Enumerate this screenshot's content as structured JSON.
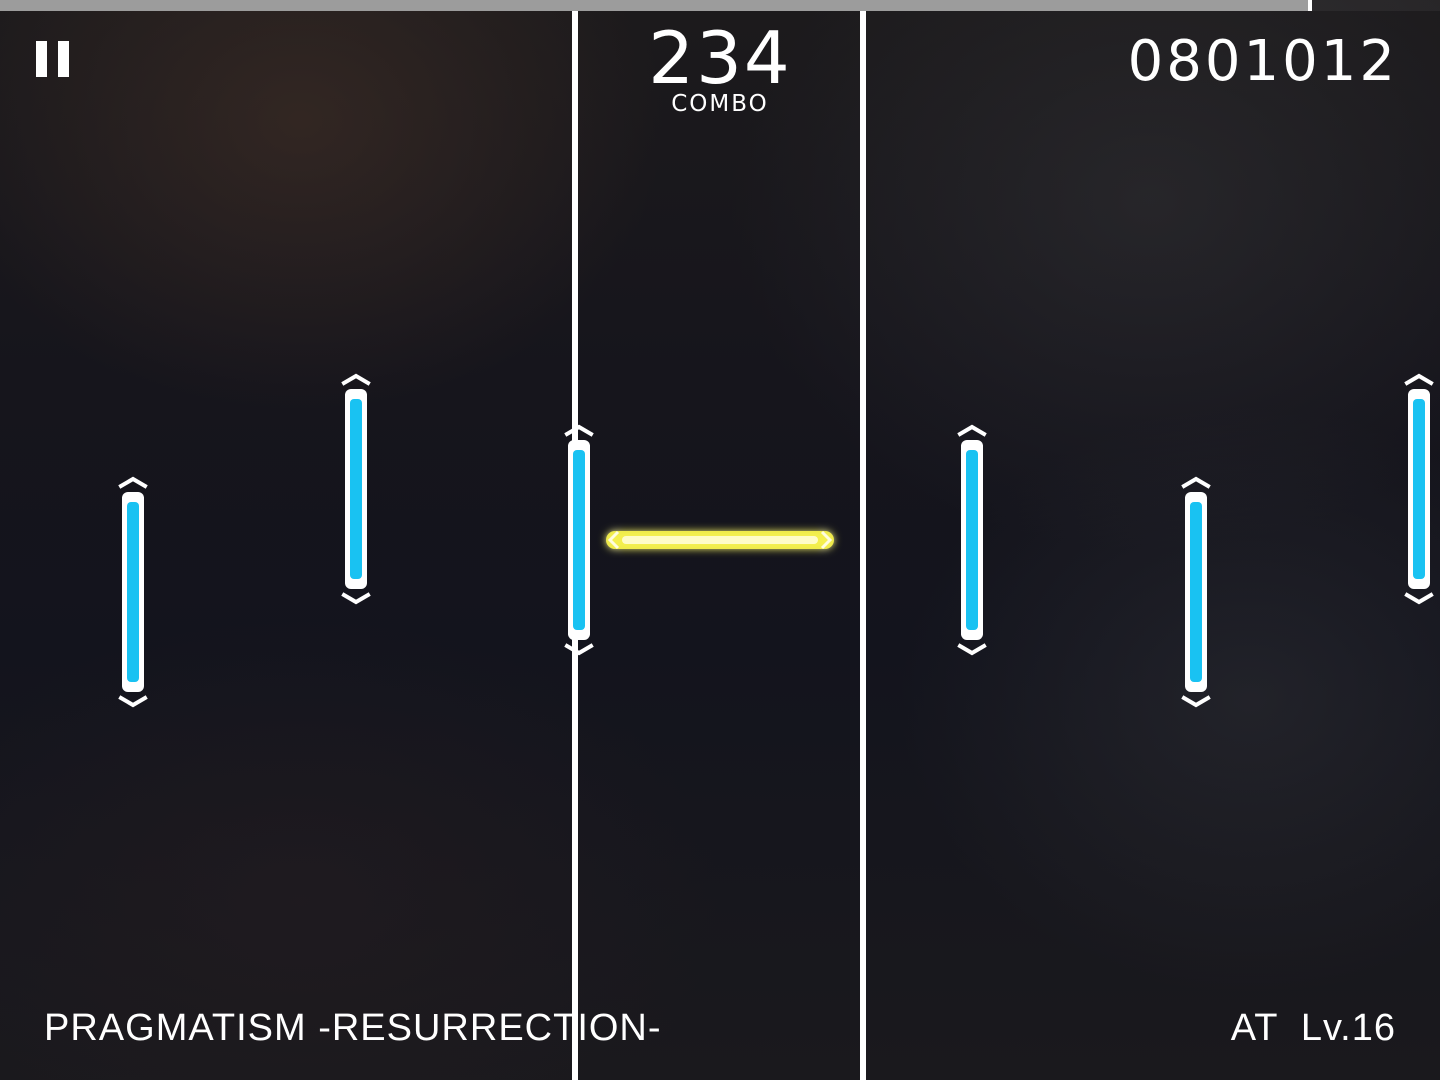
{
  "hud": {
    "pause_icon": "pause-icon",
    "combo_value": "234",
    "combo_label": "COMBO",
    "score": "0801012",
    "song_title": "PRAGMATISM -RESURRECTION-",
    "difficulty": "AT  Lv.16",
    "progress_fraction": 0.91
  },
  "colors": {
    "tap_note": "#19c2f2",
    "slide_note": "#f4f04a",
    "lane_line": "#ffffff",
    "progress_fill": "#9c9c9c"
  },
  "notes": [
    {
      "type": "tap",
      "orientation": "vertical"
    },
    {
      "type": "tap",
      "orientation": "vertical"
    },
    {
      "type": "tap",
      "orientation": "vertical"
    },
    {
      "type": "slide",
      "orientation": "horizontal"
    },
    {
      "type": "tap",
      "orientation": "vertical"
    },
    {
      "type": "tap",
      "orientation": "vertical"
    },
    {
      "type": "tap",
      "orientation": "vertical"
    }
  ]
}
